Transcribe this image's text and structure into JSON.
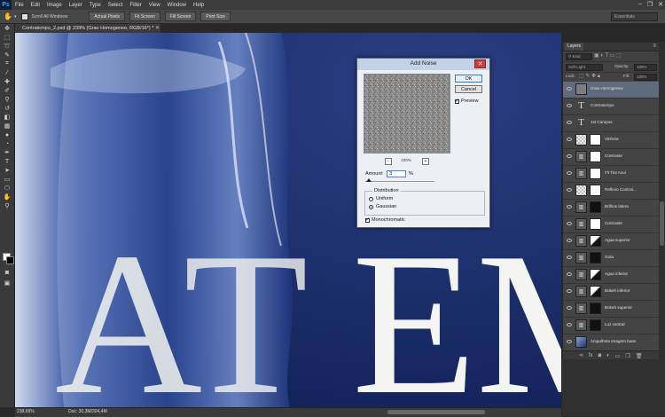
{
  "app": {
    "logo": "Ps"
  },
  "menubar": {
    "items": [
      "File",
      "Edit",
      "Image",
      "Layer",
      "Type",
      "Select",
      "Filter",
      "View",
      "Window",
      "Help"
    ],
    "window_controls": [
      "–",
      "❐",
      "✕"
    ]
  },
  "options_bar": {
    "scroll_all_windows_label": "Scroll All Windows",
    "buttons": [
      "Actual Pixels",
      "Fit Screen",
      "Fill Screen",
      "Print Size"
    ],
    "workspace": "Essentials"
  },
  "document": {
    "tab_title": "Contratempo_2.psd @ 239% (Grao Homogeneo, RGB/16*) *",
    "canvas_letters": [
      "A",
      "T",
      "E",
      "M"
    ],
    "canvas_bg": "#1a2d68"
  },
  "status_bar": {
    "zoom": "238,69%",
    "doc_info": "Doc: 30,3M/304,4M"
  },
  "layers_panel": {
    "tab": "Layers",
    "filter_kind": "Kind",
    "blend_mode": "Soft Light",
    "opacity_label": "Opacity:",
    "opacity_value": "100%",
    "lock_label": "Lock:",
    "fill_label": "Fill:",
    "fill_value": "100%",
    "layers": [
      {
        "name": "Grao Homogeneo",
        "selected": true,
        "thumb": "noise",
        "mask": "none"
      },
      {
        "name": "Contratempo",
        "thumb": "text",
        "mask": "none"
      },
      {
        "name": "1st Campus",
        "thumb": "text",
        "mask": "none"
      },
      {
        "name": "Vinheta",
        "thumb": "check",
        "mask": "white"
      },
      {
        "name": "Contraste",
        "thumb": "adj",
        "mask": "white"
      },
      {
        "name": "Flt Tint Azul",
        "thumb": "adj",
        "mask": "white"
      },
      {
        "name": "Reflexo Contrat...",
        "thumb": "check",
        "mask": "white"
      },
      {
        "name": "Brilhos latera",
        "thumb": "adj",
        "mask": "dark"
      },
      {
        "name": "Contraste",
        "thumb": "adj",
        "mask": "white"
      },
      {
        "name": "Agua superior",
        "thumb": "adj",
        "mask": "mix"
      },
      {
        "name": "Gota",
        "thumb": "adj",
        "mask": "dark"
      },
      {
        "name": "Agua inferior",
        "thumb": "adj",
        "mask": "mix"
      },
      {
        "name": "Bokeh inferior",
        "thumb": "adj",
        "mask": "mix"
      },
      {
        "name": "Bokeh superior",
        "thumb": "adj",
        "mask": "dark"
      },
      {
        "name": "Luz central",
        "thumb": "adj",
        "mask": "dark"
      },
      {
        "name": "Ampulheta Imagem base",
        "thumb": "photo",
        "mask": "none"
      }
    ],
    "footer_icons": [
      "link-icon",
      "fx-icon",
      "mask-icon",
      "adjustment-icon",
      "folder-icon",
      "new-layer-icon",
      "trash-icon"
    ]
  },
  "add_noise_dialog": {
    "title": "Add Noise",
    "ok": "OK",
    "cancel": "Cancel",
    "preview_label": "Preview",
    "preview_checked": true,
    "zoom_minus": "-",
    "zoom_plus": "+",
    "preview_zoom": "100%",
    "amount_label": "Amount:",
    "amount_value": "3",
    "amount_unit": "%",
    "amount_fraction": 0.03,
    "distribution_label": "Distribution",
    "uniform_label": "Uniform",
    "gaussian_label": "Gaussian",
    "selected_distribution": "Gaussian",
    "monochromatic_label": "Monochromatic",
    "monochromatic_checked": true
  }
}
